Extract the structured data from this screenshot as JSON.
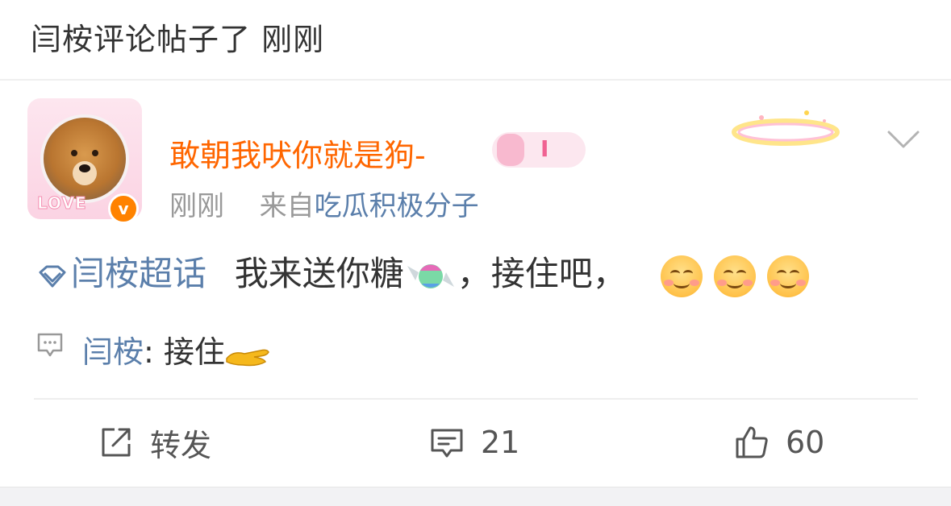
{
  "header": {
    "title": "闫桉评论帖子了 刚刚"
  },
  "post": {
    "username": "敢朝我吠你就是狗-",
    "badge_text": "I",
    "avatar_text": "LOVE",
    "time": "刚刚",
    "source_prefix": "来自",
    "source": "吃瓜积极分子",
    "topic": "闫桉超话",
    "body": "我来送你糖",
    "body_tail": "，接住吧，"
  },
  "comment": {
    "user": "闫桉",
    "separator": ": ",
    "text": "接住"
  },
  "actions": {
    "repost_label": "转发",
    "comments_count": "21",
    "likes_count": "60"
  },
  "colors": {
    "username": "#ff6600",
    "link": "#5b7fab",
    "verified": "#ff8200"
  }
}
